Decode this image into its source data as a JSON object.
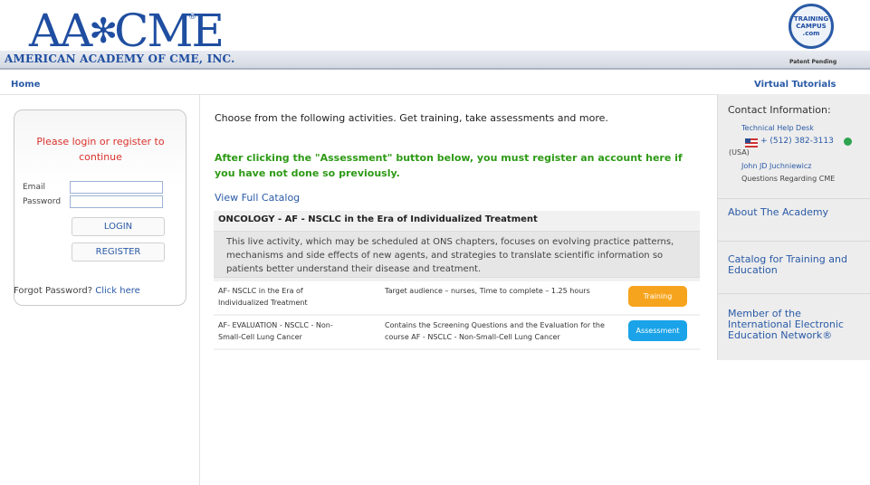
{
  "header": {
    "logo_text": "AA",
    "logo_star": "✻",
    "logo_text2": "CME",
    "logo_reg": "®",
    "logo_subtitle": "AMERICAN ACADEMY OF CME, INC.",
    "seal_text": "TRAINING CAMPUS .com",
    "patent": "Patent Pending"
  },
  "nav": {
    "home": "Home",
    "tutorials": "Virtual Tutorials"
  },
  "login": {
    "message": "Please login or register to continue",
    "email_label": "Email",
    "password_label": "Password",
    "email_value": "",
    "password_value": "",
    "login_button": "LOGIN",
    "register_button": "REGISTER",
    "forgot_text": "Forgot Password?",
    "forgot_link": "Click here"
  },
  "main": {
    "intro": "Choose from the following activities. Get training, take assessments and more.",
    "warning": "After clicking the \"Assessment\" button below, you must register an account here if you have not done so previously.",
    "catalog_link": "View Full Catalog",
    "course": {
      "title": "ONCOLOGY - AF - NSCLC in the Era of Individualized Treatment",
      "description": "This live activity, which may be scheduled at ONS chapters, focuses on evolving practice patterns, mechanisms and side effects of new agents, and strategies to translate scientific information so patients better understand their disease and treatment.",
      "rows": [
        {
          "name": "AF- NSCLC in the Era of Individualized Treatment",
          "info": "Target audience – nurses, Time to complete – 1.25 hours",
          "button": "Training"
        },
        {
          "name": "AF- EVALUATION - NSCLC - Non-Small-Cell Lung Cancer",
          "info": "Contains the Screening Questions and the Evaluation for the course AF - NSCLC - Non-Small-Cell Lung Cancer",
          "button": "Assessment"
        }
      ]
    }
  },
  "sidebar": {
    "contact_title": "Contact Information:",
    "helpdesk": "Technical Help Desk",
    "phone": "+ (512) 382-3113",
    "country": "(USA)",
    "person": "John JD Juchniewicz",
    "questions": "Questions Regarding CME",
    "links": [
      "About The Academy",
      "Catalog for Training and Education",
      "Member of the International Electronic Education Network®"
    ]
  },
  "colors": {
    "brand_blue": "#1f4ea1",
    "link_blue": "#2a5aa6",
    "warning_green": "#2d9a15",
    "error_red": "#d9302c",
    "training_orange": "#f6a41d",
    "assessment_blue": "#1aa3e8"
  }
}
